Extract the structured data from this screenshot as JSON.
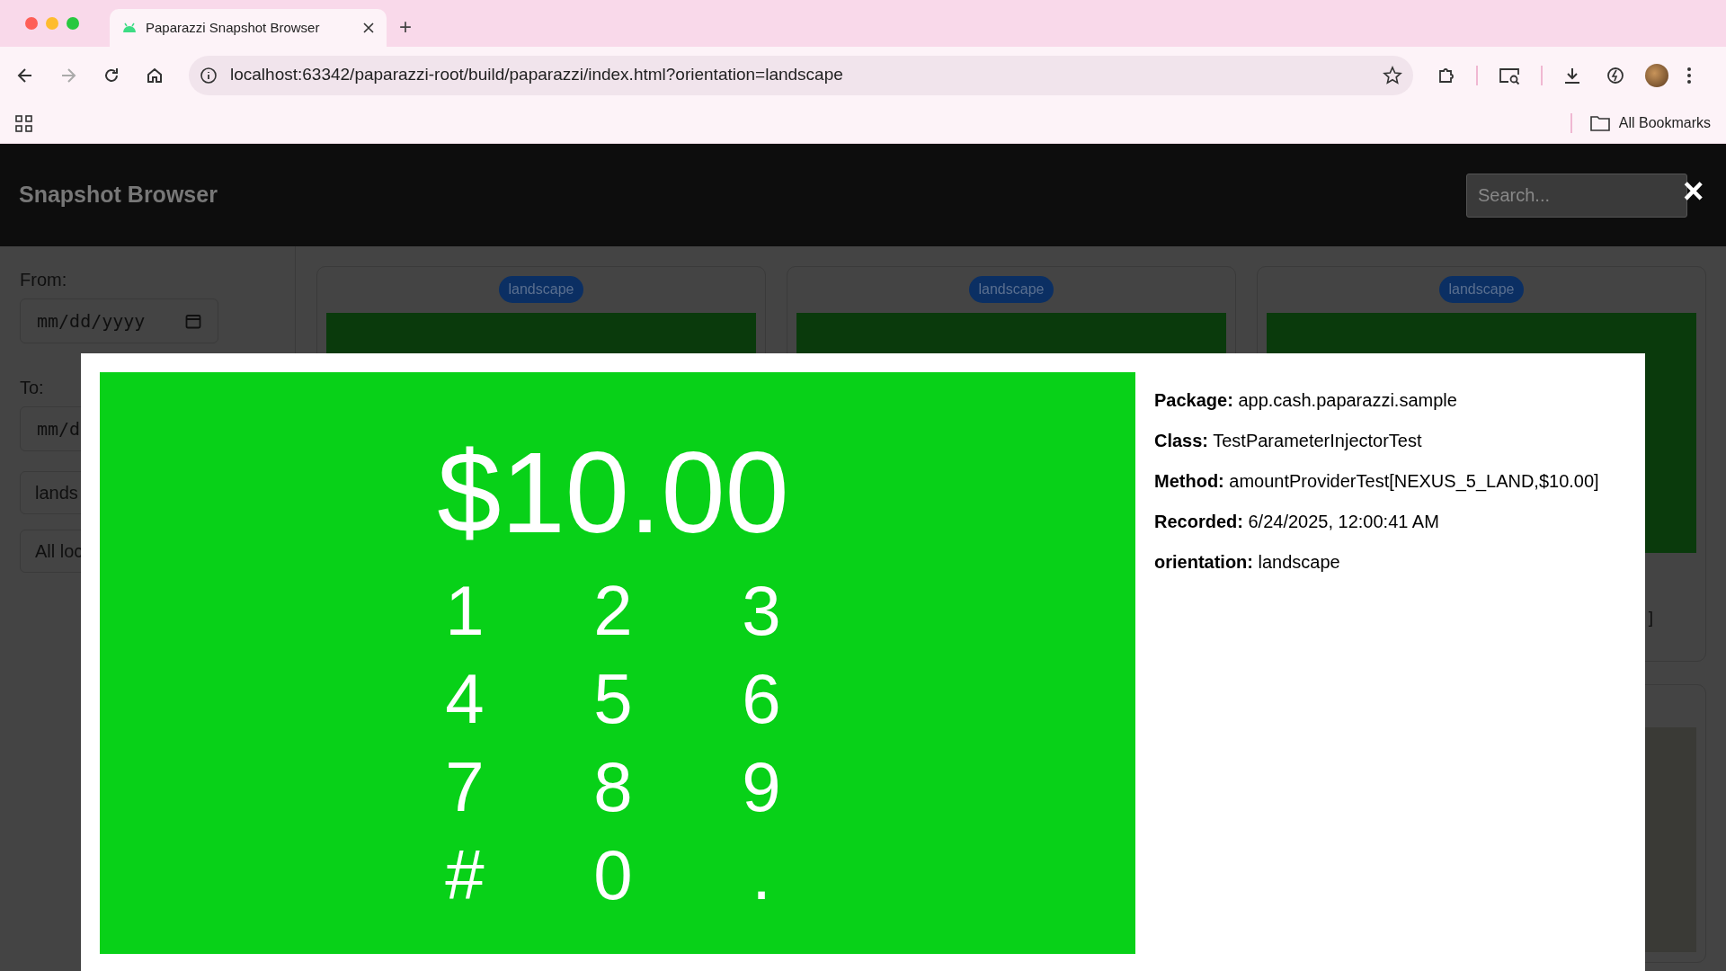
{
  "browser": {
    "tab_title": "Paparazzi Snapshot Browser",
    "new_tab": "+",
    "url": "localhost:63342/paparazzi-root/build/paparazzi/index.html?orientation=landscape",
    "bookmarks_label": "All Bookmarks"
  },
  "app": {
    "title": "Snapshot Browser",
    "search_placeholder": "Search..."
  },
  "filters": {
    "from_label": "From:",
    "from_value": "mm/dd/yyyy",
    "to_label": "To:",
    "to_value": "mm/d",
    "orientation_value": "lands",
    "locale_value": "All loc"
  },
  "cards": [
    {
      "badge": "landscape"
    },
    {
      "badge": "landscape"
    },
    {
      "badge": "landscape",
      "caption": "]"
    }
  ],
  "modal": {
    "close": "×",
    "snapshot": {
      "amount": "$10.00",
      "keys": [
        "1",
        "2",
        "3",
        "4",
        "5",
        "6",
        "7",
        "8",
        "9",
        "#",
        "0",
        "."
      ]
    },
    "details": [
      "**Package:** app.cash.paparazzi.sample",
      "**Class:** TestParameterInjectorTest",
      "**Method:** amountProviderTest[NEXUS_5_LAND,$10.00]",
      "**Recorded:** 6/24/2025, 12:00:41 AM",
      "**orientation:** landscape"
    ]
  }
}
